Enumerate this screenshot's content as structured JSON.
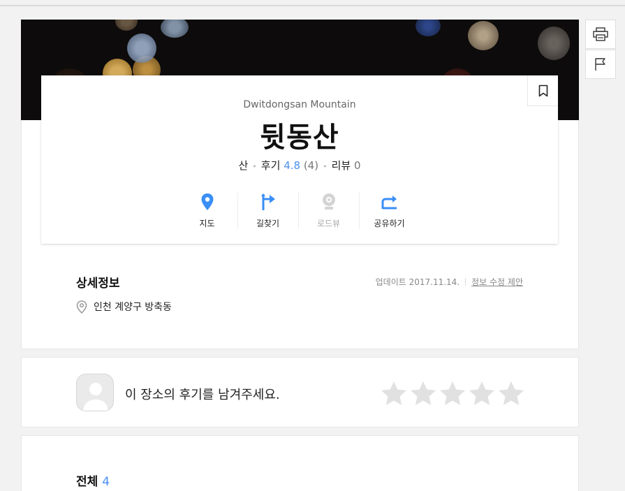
{
  "place": {
    "english_name": "Dwitdongsan Mountain",
    "korean_name": "뒷동산",
    "category": "산",
    "review_label": "후기",
    "rating": "4.8",
    "review_count": "(4)",
    "blog_review_label": "리뷰",
    "blog_review_count": "0"
  },
  "actions": [
    {
      "label": "지도",
      "icon": "map-pin-icon",
      "enabled": true
    },
    {
      "label": "길찾기",
      "icon": "directions-icon",
      "enabled": true
    },
    {
      "label": "로드뷰",
      "icon": "roadview-icon",
      "enabled": false
    },
    {
      "label": "공유하기",
      "icon": "share-icon",
      "enabled": true
    }
  ],
  "detail": {
    "title": "상세정보",
    "updated": "업데이트 2017.11.14.",
    "suggest_edit": "정보 수정 제안",
    "address": "인천 계양구 방축동"
  },
  "review_prompt": {
    "text": "이 장소의 후기를 남겨주세요.",
    "max_stars": 5,
    "current_rating": 0
  },
  "reviews": {
    "label": "전체",
    "count": "4"
  },
  "colors": {
    "accent": "#4c8ff3",
    "map_blue": "#3a8ef6",
    "star_empty": "#e1e1e1"
  }
}
